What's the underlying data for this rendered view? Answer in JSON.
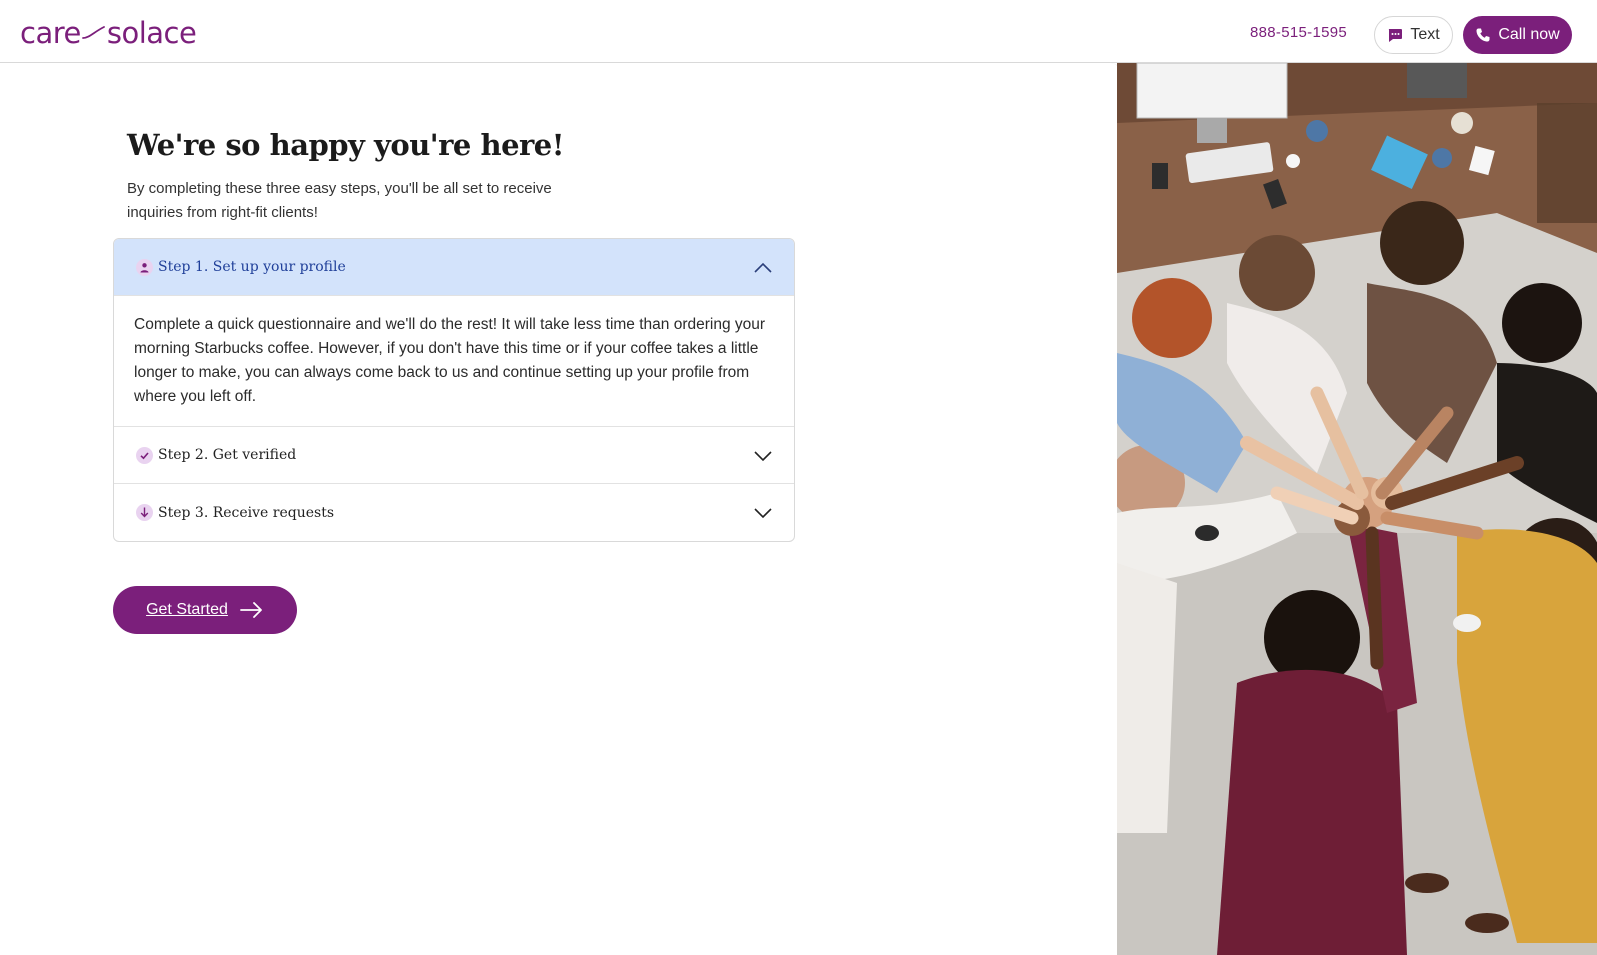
{
  "header": {
    "logo_left": "care",
    "logo_right": "solace",
    "phone": "888-515-1595",
    "text_button": "Text",
    "call_button": "Call now"
  },
  "intro": {
    "title": "We're so happy you're here!",
    "subtitle": "By completing these three easy steps, you'll be all set to receive inquiries from right-fit clients!"
  },
  "steps": [
    {
      "label": "Step 1. Set up your profile",
      "icon": "person-icon",
      "expanded": true,
      "body": "Complete a quick questionnaire and we'll do the rest! It will take less time than ordering your morning Starbucks coffee. However, if you don't have this time or if your coffee takes a little longer to make, you can always come back to us and continue setting up your profile from where you left off."
    },
    {
      "label": "Step 2. Get verified",
      "icon": "verified-check-icon",
      "expanded": false
    },
    {
      "label": "Step 3. Receive requests",
      "icon": "arrow-down-icon",
      "expanded": false
    }
  ],
  "cta": {
    "label": "Get Started"
  },
  "colors": {
    "brand": "#7b1f7b",
    "accordion_open_bg": "#d3e3fb"
  }
}
